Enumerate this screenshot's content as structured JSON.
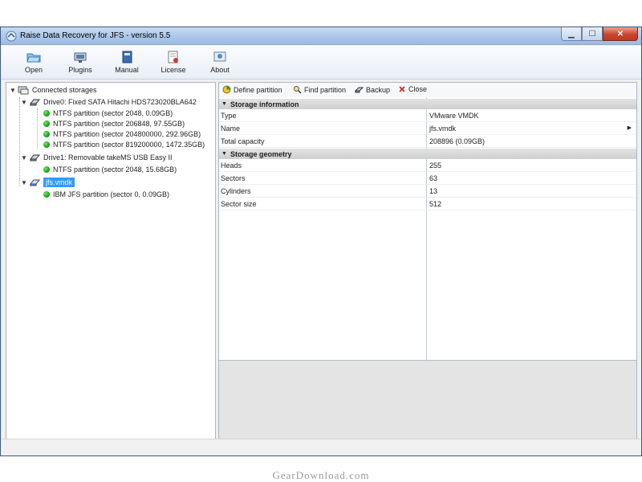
{
  "window": {
    "title": "Raise Data Recovery for JFS - version 5.5",
    "controls": {
      "minimize": "▁",
      "maximize": "☐",
      "close": "✕"
    }
  },
  "toolbar": {
    "items": [
      {
        "label": "Open",
        "icon": "open-folder-icon"
      },
      {
        "label": "Plugins",
        "icon": "plugins-icon"
      },
      {
        "label": "Manual",
        "icon": "manual-book-icon"
      },
      {
        "label": "License",
        "icon": "license-icon"
      },
      {
        "label": "About",
        "icon": "about-icon"
      }
    ]
  },
  "tree": {
    "root": "Connected storages",
    "drives": [
      {
        "label": "Drive0: Fixed SATA Hitachi HDS723020BLA642",
        "partitions": [
          "NTFS partition (sector 2048, 0.09GB)",
          "NTFS partition (sector 206848, 97.55GB)",
          "NTFS partition (sector 204800000, 292.96GB)",
          "NTFS partition (sector 819200000, 1472.35GB)"
        ]
      },
      {
        "label": "Drive1: Removable takeMS USB Easy II",
        "partitions": [
          "NTFS partition (sector 2048, 15.68GB)"
        ]
      },
      {
        "label": "jfs.vmdk",
        "selected": true,
        "partitions": [
          "IBM JFS partition (sector 0, 0.09GB)"
        ]
      }
    ]
  },
  "actions": {
    "define_partition": "Define partition",
    "find_partition": "Find partition",
    "backup": "Backup",
    "close": "Close"
  },
  "properties": {
    "storage_information": {
      "header": "Storage information",
      "rows": [
        {
          "name": "Type",
          "value": "VMware VMDK"
        },
        {
          "name": "Name",
          "value": "jfs.vmdk"
        },
        {
          "name": "Total capacity",
          "value": "208896 (0.09GB)"
        }
      ]
    },
    "storage_geometry": {
      "header": "Storage geometry",
      "rows": [
        {
          "name": "Heads",
          "value": "255"
        },
        {
          "name": "Sectors",
          "value": "63"
        },
        {
          "name": "Cylinders",
          "value": "13"
        },
        {
          "name": "Sector size",
          "value": "512"
        }
      ]
    }
  },
  "watermark": "GearDownload.com",
  "colors": {
    "status_ok": "#11a511",
    "selection": "#3399ff",
    "titlebar": "#a9c5e8"
  }
}
